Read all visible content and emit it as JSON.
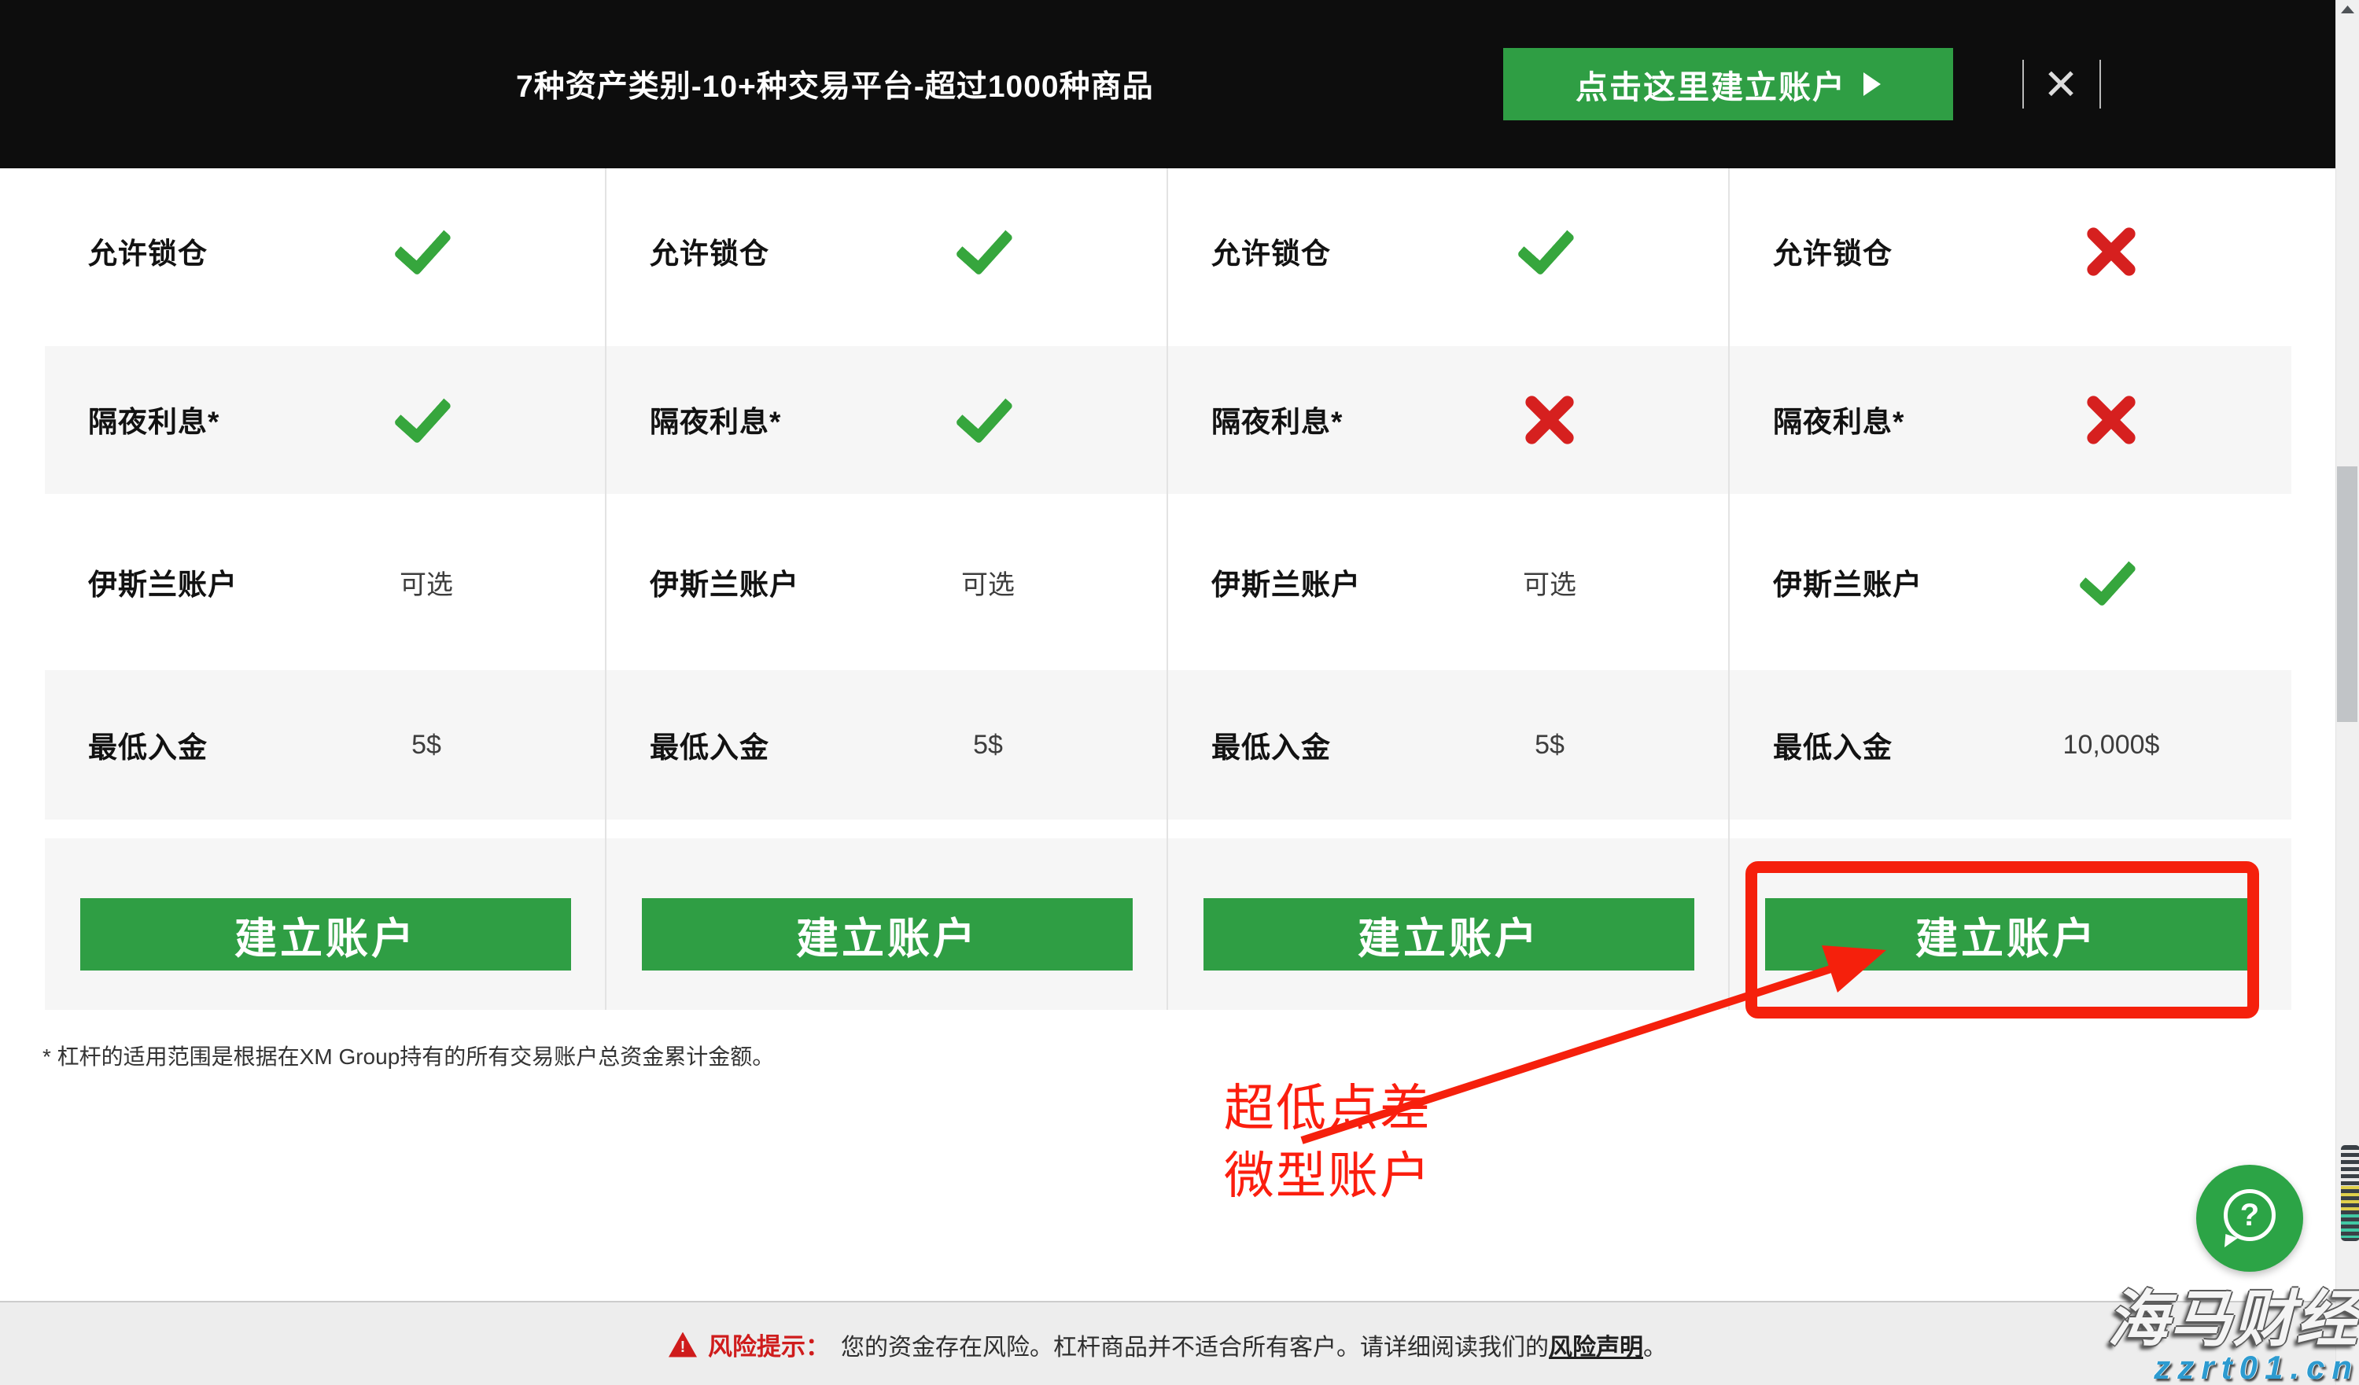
{
  "top_bar": {
    "headline": "7种资产类别-10+种交易平台-超过1000种商品",
    "cta_label": "点击这里建立账户",
    "close_label": "✕"
  },
  "table": {
    "features": [
      {
        "label": "允许锁仓",
        "cells": [
          {
            "v": "",
            "t": "check"
          },
          {
            "v": "",
            "t": "check"
          },
          {
            "v": "",
            "t": "check"
          },
          {
            "v": "",
            "t": "cross"
          }
        ]
      },
      {
        "label": "隔夜利息*",
        "cells": [
          {
            "v": "",
            "t": "check"
          },
          {
            "v": "",
            "t": "check"
          },
          {
            "v": "",
            "t": "cross"
          },
          {
            "v": "",
            "t": "cross"
          }
        ]
      },
      {
        "label": "伊斯兰账户",
        "cells": [
          {
            "v": "可选",
            "t": "text"
          },
          {
            "v": "可选",
            "t": "text"
          },
          {
            "v": "可选",
            "t": "text"
          },
          {
            "v": "",
            "t": "check"
          }
        ]
      },
      {
        "label": "最低入金",
        "cells": [
          {
            "v": "5$",
            "t": "text"
          },
          {
            "v": "5$",
            "t": "text"
          },
          {
            "v": "5$",
            "t": "text"
          },
          {
            "v": "10,000$",
            "t": "text"
          }
        ]
      }
    ],
    "button_label": "建立账户"
  },
  "footnote": "* 杠杆的适用范围是根据在XM Group持有的所有交易账户总资金累计金额。",
  "annotation": {
    "line1": "超低点差",
    "line2": "微型账户"
  },
  "risk_bar": {
    "warning_mark": "!",
    "title": "风险提示：",
    "body": "您的资金存在风险。杠杆商品并不适合所有客户。请详细阅读我们的",
    "link": "风险声明",
    "suffix": "。"
  },
  "chat": {
    "icon_glyph": "?"
  },
  "watermark": {
    "title": "海马财经",
    "url": "zzrt01.cn"
  },
  "colors": {
    "accent_green": "#2f9e44",
    "check_green": "#36a63d",
    "cross_red": "#d6201f",
    "annotation_red": "#f5200c",
    "topbar_black": "#0d0d0d",
    "row_gray": "#f6f6f6"
  }
}
